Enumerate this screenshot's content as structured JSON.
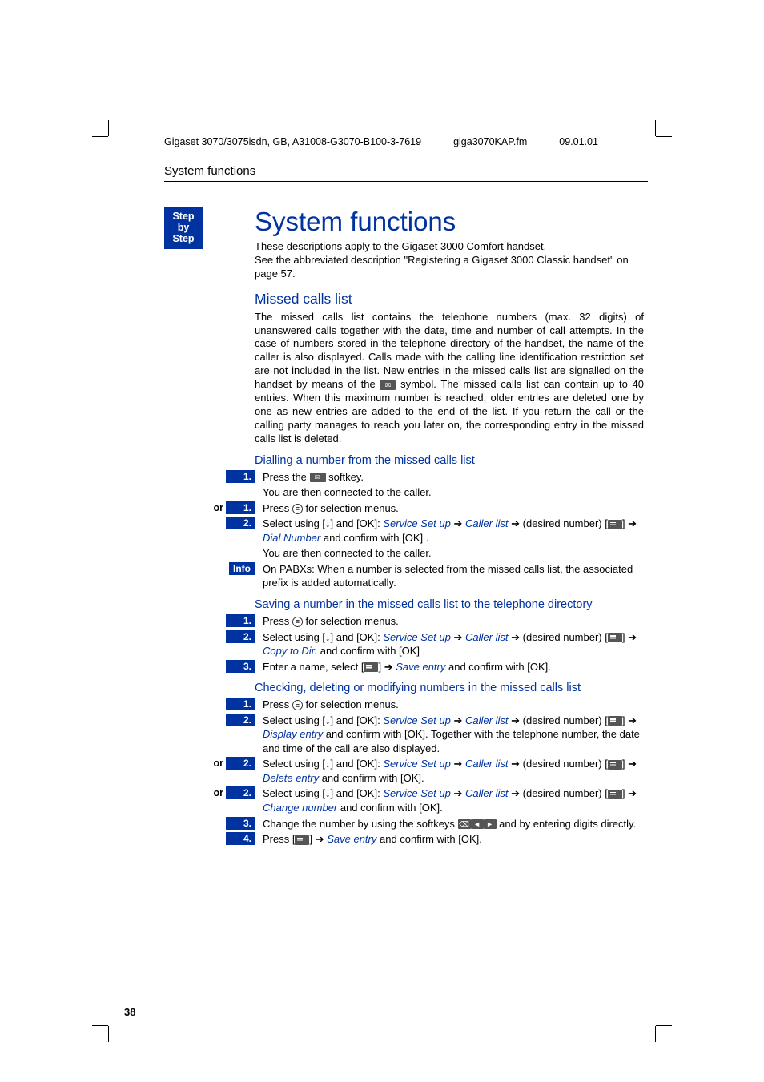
{
  "meta": {
    "doc": "Gigaset 3070/3075isdn, GB, A31008-G3070-B100-3-7619",
    "file": "giga3070KAP.fm",
    "date": "09.01.01"
  },
  "header": "System functions",
  "sidetab": {
    "l1": "Step",
    "l2": "by",
    "l3": "Step"
  },
  "title": "System functions",
  "intro1": "These descriptions apply to the Gigaset 3000 Comfort handset.",
  "intro2": "See the abbreviated description \"Registering a Gigaset 3000 Classic handset\" on page 57.",
  "h2_missed": "Missed calls list",
  "missed_body": "The missed calls list contains the telephone numbers (max. 32 digits) of unanswered calls together with the date, time and number of call attempts. In the case of numbers stored in the telephone directory of the handset, the name of the caller is also displayed. Calls made with the calling line identification restriction set are not included in the list. New entries in the missed calls list are signalled on the handset by means of the      symbol. The missed calls list can contain up to 40 entries. When this maximum number is reached, older entries are deleted one by one as new entries are added to the end of the list. If you return the call or the calling party manages to reach you later on, the corresponding entry in the missed calls list is deleted.",
  "h3_dial": "Dialling a number from the missed calls list",
  "dial": {
    "s1": "Press the      softkey.",
    "s1b": "You are then connected to the caller.",
    "or1": "Press      for selection menus.",
    "s2a": "Select using [↓] and [OK]: ",
    "s2_service": "Service Set up",
    "s2_caller": "Caller list",
    "s2_desired": "(desired number)",
    "s2_dialnum": "Dial Number",
    "s2_confirm": " and confirm with [OK] .",
    "s2b": "You are then connected to the caller.",
    "info": "On PABXs: When a number is selected from the missed calls list, the associated prefix is added automatically."
  },
  "h3_save": "Saving a number in the missed calls list to the telephone directory",
  "save": {
    "s1": "Press      for selection menus.",
    "s2a": "Select using [↓] and [OK]: ",
    "s2_service": "Service Set up",
    "s2_caller": "Caller list",
    "s2_desired": "(desired number)",
    "s2_copy": "Copy to Dir.",
    "s2_confirm": " and confirm with [OK] .",
    "s3a": "Enter a name, select ",
    "s3_save": "Save entry",
    "s3b": " and confirm with [OK]."
  },
  "h3_check": "Checking, deleting or modifying numbers in the missed calls list",
  "check": {
    "s1": "Press      for selection menus.",
    "s2a": "Select using [↓] and [OK]: ",
    "service": "Service Set up",
    "caller": "Caller list",
    "desired": "(desired number)",
    "display": "Display entry",
    "s2b": " and confirm with [OK]. Together with the telephone number, the date and time of the call are also displayed.",
    "delete": "Delete entry",
    "or2b": " and confirm with [OK].",
    "change": "Change number",
    "or3b": " and confirm with [OK].",
    "s3": "Change the number by using the softkeys                and by entering digits directly.",
    "s4a": "Press ",
    "s4_save": "Save entry",
    "s4b": " and confirm with [OK]."
  },
  "labels": {
    "or": "or",
    "info": "Info",
    "n1": "1.",
    "n2": "2.",
    "n3": "3.",
    "n4": "4."
  },
  "pagenum": "38",
  "chart_data": {
    "type": "table",
    "note": "no chart present"
  }
}
